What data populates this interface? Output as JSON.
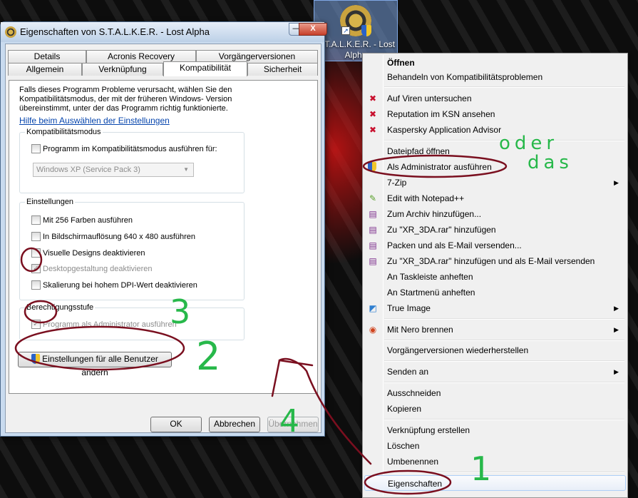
{
  "desktop_icon": {
    "label": "S.T.A.L.K.E.R. - Lost Alpha"
  },
  "dialog": {
    "title": "Eigenschaften von S.T.A.L.K.E.R. - Lost Alpha",
    "minimize": "—",
    "close": "X",
    "tabs_row1": [
      "Details",
      "Acronis Recovery",
      "Vorgängerversionen"
    ],
    "tabs_row2": [
      "Allgemein",
      "Verknüpfung",
      "Kompatibilität",
      "Sicherheit"
    ],
    "intro": "Falls dieses Programm Probleme verursacht, wählen Sie den Kompatibilitätsmodus, der mit der früheren Windows- Version übereinstimmt, unter der das Programm richtig funktionierte.",
    "help_link": "Hilfe beim Auswählen der Einstellungen",
    "compat_group": {
      "title": "Kompatibilitätsmodus",
      "checkbox": "Programm im Kompatibilitätsmodus ausführen für:",
      "select_value": "Windows XP (Service Pack 3)"
    },
    "settings_group": {
      "title": "Einstellungen",
      "items": [
        "Mit 256 Farben ausführen",
        "In Bildschirmauflösung 640 x 480 ausführen",
        "Visuelle Designs deaktivieren",
        "Desktopgestaltung deaktivieren",
        "Skalierung bei hohem DPI-Wert deaktivieren"
      ]
    },
    "privilege_group": {
      "title": "Berechtigungsstufe",
      "checkbox": "Programm als Administrator ausführen"
    },
    "all_users_button": "Einstellungen für alle Benutzer ändern",
    "ok": "OK",
    "cancel": "Abbrechen",
    "apply": "Übernehmen"
  },
  "context_menu": {
    "items": [
      "Öffnen",
      "Behandeln von Kompatibilitätsproblemen",
      "Auf Viren untersuchen",
      "Reputation im KSN ansehen",
      "Kaspersky Application Advisor",
      "Dateipfad öffnen",
      "Als Administrator ausführen",
      "7-Zip",
      "Edit with Notepad++",
      "Zum Archiv hinzufügen...",
      "Zu \"XR_3DA.rar\" hinzufügen",
      "Packen und als E-Mail versenden...",
      "Zu \"XR_3DA.rar\" hinzufügen und als E-Mail versenden",
      "An Taskleiste anheften",
      "An Startmenü anheften",
      "True Image",
      "Mit Nero brennen",
      "Vorgängerversionen wiederherstellen",
      "Senden an",
      "Ausschneiden",
      "Kopieren",
      "Verknüpfung erstellen",
      "Löschen",
      "Umbenennen",
      "Eigenschaften"
    ],
    "submenu_arrow": "▶",
    "icons": {
      "kaspersky": "kaspersky-icon",
      "uac": "uac-shield-icon",
      "winrar": "winrar-icon",
      "notepad": "notepad-plus-plus-icon",
      "trueimage": "true-image-icon",
      "nero": "nero-icon"
    }
  },
  "annotations": {
    "oder_das_line1": "oder",
    "oder_das_line2": "das",
    "num1": "1",
    "num2": "2",
    "num3": "3",
    "num4": "4",
    "pen_color": "#7a0f1f",
    "green": "#27b84a"
  }
}
